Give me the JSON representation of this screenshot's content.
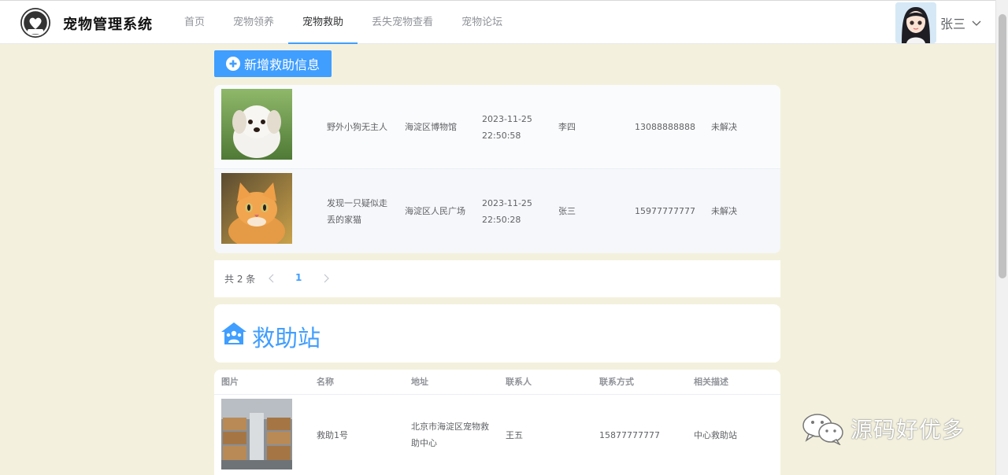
{
  "header": {
    "brand": "宠物管理系统",
    "nav": [
      {
        "label": "首页",
        "active": false
      },
      {
        "label": "宠物领养",
        "active": false
      },
      {
        "label": "宠物救助",
        "active": true
      },
      {
        "label": "丢失宠物查看",
        "active": false
      },
      {
        "label": "宠物论坛",
        "active": false
      }
    ],
    "user": {
      "name": "张三"
    }
  },
  "rescue": {
    "add_button": "新增救助信息",
    "rows": [
      {
        "image": "puppy-photo",
        "title": "野外小狗无主人",
        "location": "海淀区博物馆",
        "time": "2023-11-25 22:50:58",
        "contact": "李四",
        "phone": "13088888888",
        "status": "未解决"
      },
      {
        "image": "cat-photo",
        "title": "发现一只疑似走丢的家猫",
        "location": "海淀区人民广场",
        "time": "2023-11-25 22:50:28",
        "contact": "张三",
        "phone": "15977777777",
        "status": "未解决"
      }
    ]
  },
  "pagination": {
    "total": "共 2 条",
    "current": "1"
  },
  "station": {
    "title": "救助站",
    "columns": [
      "图片",
      "名称",
      "地址",
      "联系人",
      "联系方式",
      "相关描述"
    ],
    "rows": [
      {
        "image": "warehouse-photo",
        "name": "救助1号",
        "address": "北京市海淀区宠物救助中心",
        "contact": "王五",
        "phone": "15877777777",
        "desc": "中心救助站"
      }
    ]
  },
  "watermark": "源码好优多",
  "colors": {
    "primary": "#409eff",
    "background": "#f3f1dd"
  }
}
